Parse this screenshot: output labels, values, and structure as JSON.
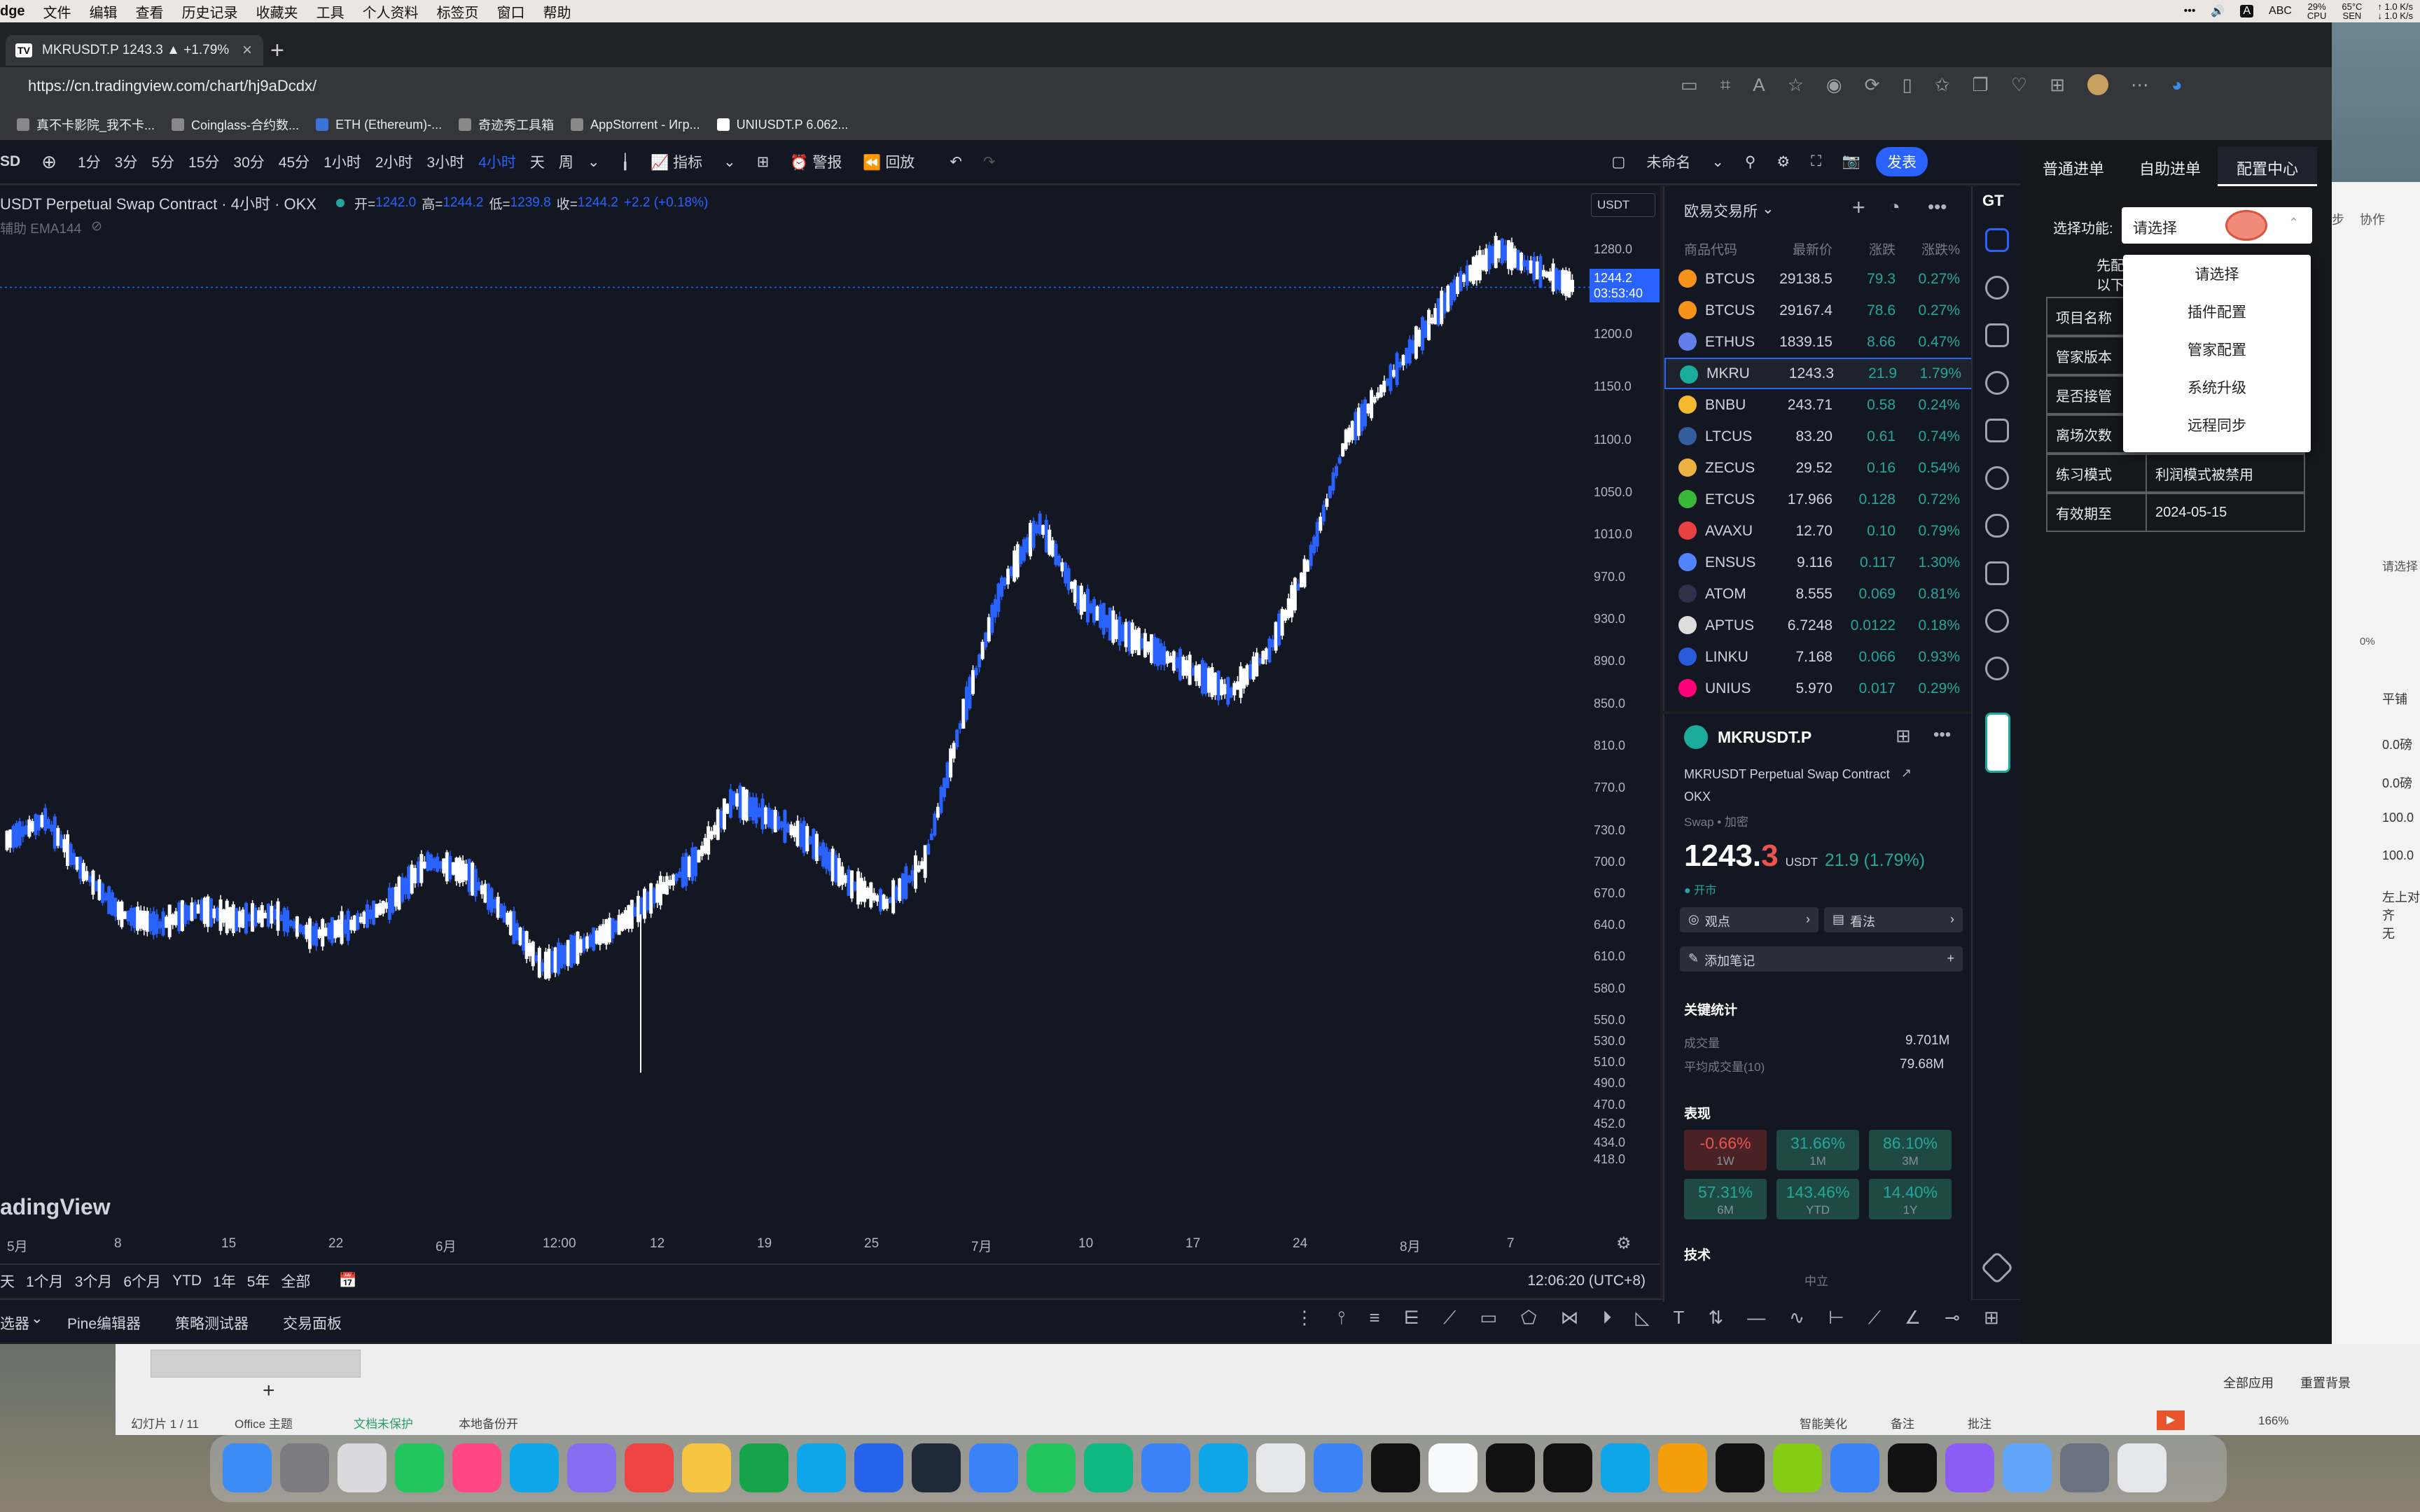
{
  "menubar": {
    "app": "dge",
    "items": [
      "文件",
      "编辑",
      "查看",
      "历史记录",
      "收藏夹",
      "工具",
      "个人资料",
      "标签页",
      "窗口",
      "帮助"
    ],
    "status": {
      "input": "ABC",
      "cpu": "29%",
      "cpu_label": "CPU",
      "temp": "65°C",
      "temp_label": "SEN",
      "net_up": "↑ 1.0 K/s",
      "net_down": "↓ 1.0 K/s",
      "ime": "A"
    }
  },
  "browser": {
    "tab_title": "MKRUSDT.P 1243.3 ▲ +1.79%",
    "tab_icon": "TV",
    "url": "https://cn.tradingview.com/chart/hj9aDcdx/",
    "bookmarks": [
      "真不卡影院_我不卡...",
      "Coinglass-合约数...",
      "ETH (Ethereum)-...",
      "奇迹秀工具箱",
      "AppStorrent - Игр...",
      "UNIUSDT.P 6.062..."
    ]
  },
  "toolbar": {
    "symbol": "SD",
    "timeframes": [
      "1分",
      "3分",
      "5分",
      "15分",
      "30分",
      "45分",
      "1小时",
      "2小时",
      "3小时",
      "4小时",
      "天",
      "周"
    ],
    "active_timeframe": "4小时",
    "indicators": "指标",
    "alert": "警报",
    "replay": "回放",
    "layout_name": "未命名",
    "publish": "发表"
  },
  "chart": {
    "title": "USDT Perpetual Swap Contract · 4小时 · OKX",
    "ohlc": {
      "o_label": "开=",
      "o": "1242.0",
      "h_label": "高=",
      "h": "1244.2",
      "l_label": "低=",
      "l": "1239.8",
      "c_label": "收=",
      "c": "1244.2",
      "change": "+2.2 (+0.18%)"
    },
    "indicator_label": "辅助 EMA144",
    "currency": "USDT",
    "last_price": "1244.2",
    "countdown": "03:53:40",
    "watermark": "adingView",
    "time_display": "12:06:20 (UTC+8)",
    "chart_data": {
      "type": "line",
      "title": "",
      "x": [
        "5月",
        "8",
        "15",
        "22",
        "6月",
        "12:00",
        "12",
        "19",
        "25",
        "7月",
        "10",
        "17",
        "24",
        "8月",
        "7"
      ],
      "ylim": [
        418,
        1300
      ],
      "yticks": [
        "1280.0",
        "1200.0",
        "1150.0",
        "1100.0",
        "1050.0",
        "1010.0",
        "970.0",
        "930.0",
        "890.0",
        "850.0",
        "810.0",
        "770.0",
        "730.0",
        "700.0",
        "670.0",
        "640.0",
        "610.0",
        "580.0",
        "550.0",
        "530.0",
        "510.0",
        "490.0",
        "470.0",
        "452.0",
        "434.0",
        "418.0"
      ],
      "series": [
        {
          "values": [
            720,
            740,
            690,
            650,
            640,
            655,
            645,
            650,
            630,
            640,
            660,
            700,
            690,
            650,
            600,
            620,
            640,
            670,
            700,
            760,
            740,
            720,
            680,
            660,
            700,
            840,
            960,
            1020,
            950,
            920,
            900,
            880,
            860,
            900,
            980,
            1100,
            1150,
            1200,
            1250,
            1280,
            1260,
            1244
          ]
        }
      ]
    }
  },
  "range_bar": {
    "items": [
      "天",
      "1个月",
      "3个月",
      "6个月",
      "YTD",
      "1年",
      "5年",
      "全部"
    ]
  },
  "bottom_panel": {
    "items": [
      "选器",
      "Pine编辑器",
      "策略测试器",
      "交易面板"
    ]
  },
  "watchlist": {
    "title": "欧易交易所",
    "headers": [
      "商品代码",
      "最新价",
      "涨跌",
      "涨跌%"
    ],
    "rows": [
      {
        "symbol": "BTCUS",
        "last": "29138.5",
        "chg": "79.3",
        "pct": "0.27%",
        "color": "#f7931a"
      },
      {
        "symbol": "BTCUS",
        "last": "29167.4",
        "chg": "78.6",
        "pct": "0.27%",
        "color": "#f7931a"
      },
      {
        "symbol": "ETHUS",
        "last": "1839.15",
        "chg": "8.66",
        "pct": "0.47%",
        "color": "#627eea"
      },
      {
        "symbol": "MKRU",
        "last": "1243.3",
        "chg": "21.9",
        "pct": "1.79%",
        "color": "#1aab9b"
      },
      {
        "symbol": "BNBU",
        "last": "243.71",
        "chg": "0.58",
        "pct": "0.24%",
        "color": "#f3ba2f"
      },
      {
        "symbol": "LTCUS",
        "last": "83.20",
        "chg": "0.61",
        "pct": "0.74%",
        "color": "#345d9d"
      },
      {
        "symbol": "ZECUS",
        "last": "29.52",
        "chg": "0.16",
        "pct": "0.54%",
        "color": "#ecb244"
      },
      {
        "symbol": "ETCUS",
        "last": "17.966",
        "chg": "0.128",
        "pct": "0.72%",
        "color": "#3ab83a"
      },
      {
        "symbol": "AVAXU",
        "last": "12.70",
        "chg": "0.10",
        "pct": "0.79%",
        "color": "#e84142"
      },
      {
        "symbol": "ENSUS",
        "last": "9.116",
        "chg": "0.117",
        "pct": "1.30%",
        "color": "#5284ff"
      },
      {
        "symbol": "ATOM",
        "last": "8.555",
        "chg": "0.069",
        "pct": "0.81%",
        "color": "#2e3148"
      },
      {
        "symbol": "APTUS",
        "last": "6.7248",
        "chg": "0.0122",
        "pct": "0.18%",
        "color": "#dddddd"
      },
      {
        "symbol": "LINKU",
        "last": "7.168",
        "chg": "0.066",
        "pct": "0.93%",
        "color": "#2a5ada"
      },
      {
        "symbol": "UNIUS",
        "last": "5.970",
        "chg": "0.017",
        "pct": "0.29%",
        "color": "#ff007a"
      }
    ]
  },
  "detail": {
    "symbol": "MKRUSDT.P",
    "description": "MKRUSDT Perpetual Swap Contract",
    "exchange": "OKX",
    "type": "Swap • 加密",
    "price": "1243.",
    "price_last_digit": "3",
    "currency": "USDT",
    "change": "21.9 (1.79%)",
    "market_status": "● 开市",
    "opinion": "观点",
    "view": "看法",
    "add_note": "添加笔记",
    "key_stats": "关键统计",
    "volume_label": "成交量",
    "volume": "9.701M",
    "avg_volume_label": "平均成交量(10)",
    "avg_volume": "79.68M",
    "performance_label": "表现",
    "performance": [
      {
        "value": "-0.66%",
        "period": "1W",
        "dir": "down"
      },
      {
        "value": "31.66%",
        "period": "1M",
        "dir": "up"
      },
      {
        "value": "86.10%",
        "period": "3M",
        "dir": "up"
      },
      {
        "value": "57.31%",
        "period": "6M",
        "dir": "up"
      },
      {
        "value": "143.46%",
        "period": "YTD",
        "dir": "up"
      },
      {
        "value": "14.40%",
        "period": "1Y",
        "dir": "up"
      }
    ],
    "tech_label": "技术",
    "tech_value": "中立"
  },
  "extension": {
    "tabs": [
      "普通进单",
      "自助进单",
      "配置中心"
    ],
    "function_label": "选择功能:",
    "select_value": "请选择",
    "dropdown_items": [
      "请选择",
      "插件配置",
      "管家配置",
      "系统升级",
      "远程同步"
    ],
    "partial_text": "先配\n以下",
    "table": [
      {
        "label": "项目名称",
        "value": ""
      },
      {
        "label": "管家版本",
        "value": ""
      },
      {
        "label": "是否接管",
        "value": ""
      },
      {
        "label": "离场次数",
        "value": ""
      },
      {
        "label": "练习模式",
        "value": "利润模式被禁用"
      },
      {
        "label": "有效期至",
        "value": "2024-05-15"
      }
    ],
    "badge": "GT"
  },
  "ppt": {
    "slide_info": "幻灯片 1 / 11",
    "theme": "Office 主题",
    "protect": "文档未保护",
    "backup": "本地备份开",
    "smart": "智能美化",
    "notes": "备注",
    "comments": "批注",
    "zoom": "166%",
    "apply_all": "全部应用",
    "reset_bg": "重置背景",
    "right_labels": [
      "步",
      "协作",
      "请选择",
      "平铺",
      "0.0磅",
      "0.0磅",
      "100.0",
      "100.0",
      "左上对齐",
      "无",
      "0%"
    ]
  }
}
